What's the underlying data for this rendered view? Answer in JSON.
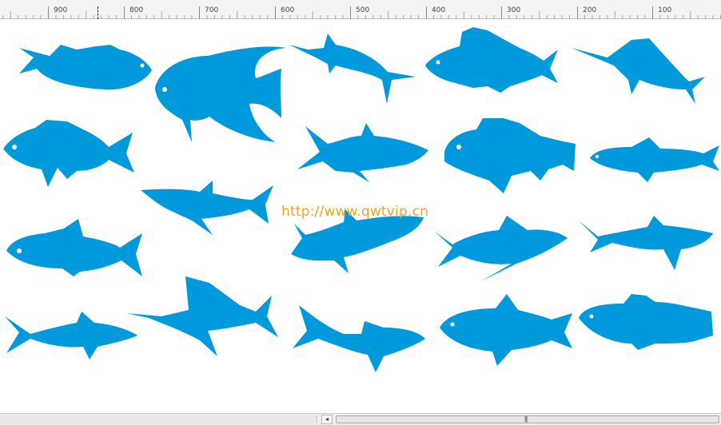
{
  "ruler": {
    "labels": [
      "900",
      "800",
      "700",
      "600",
      "500",
      "400",
      "300",
      "200",
      "100"
    ]
  },
  "watermark": "http://www.qwtvip.cn",
  "colors": {
    "fish": "#0099db",
    "watermark": "#f2a51a",
    "ruler_bg": "#f3f3f3"
  },
  "scrollbar": {
    "left_arrow": "◂",
    "thumb_grip": "|||",
    "split_grip": "⋮"
  }
}
